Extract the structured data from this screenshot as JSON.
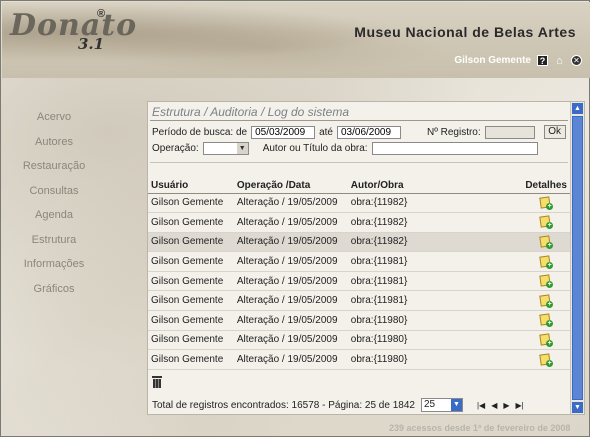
{
  "header": {
    "logo_text": "Donato",
    "logo_registered": "®",
    "logo_version": "3.1",
    "museum_name": "Museu Nacional de Belas Artes",
    "username": "Gilson Gemente",
    "icons": [
      "help-icon",
      "home-icon",
      "close-icon"
    ]
  },
  "sidebar": {
    "items": [
      {
        "label": "Acervo"
      },
      {
        "label": "Autores"
      },
      {
        "label": "Restauração"
      },
      {
        "label": "Consultas"
      },
      {
        "label": "Agenda"
      },
      {
        "label": "Estrutura"
      },
      {
        "label": "Informações"
      },
      {
        "label": "Gráficos"
      }
    ]
  },
  "panel": {
    "title": "Estrutura / Auditoria / Log do sistema",
    "filters": {
      "periodo_label": "Período de busca: de",
      "date_from": "05/03/2009",
      "ate_label": "até",
      "date_to": "03/06/2009",
      "registro_label": "Nº Registro:",
      "registro_value": "",
      "ok_label": "Ok",
      "operacao_label": "Operação:",
      "operacao_value": "",
      "autor_label": "Autor ou Título da obra:",
      "autor_value": ""
    },
    "table": {
      "columns": [
        "Usuário",
        "Operação /Data",
        "Autor/Obra",
        "Detalhes"
      ],
      "rows": [
        {
          "usuario": "Gilson Gemente",
          "operacao": "Alteração / 19/05/2009",
          "obra": "obra:{11982}"
        },
        {
          "usuario": "Gilson Gemente",
          "operacao": "Alteração / 19/05/2009",
          "obra": "obra:{11982}"
        },
        {
          "usuario": "Gilson Gemente",
          "operacao": "Alteração / 19/05/2009",
          "obra": "obra:{11982}"
        },
        {
          "usuario": "Gilson Gemente",
          "operacao": "Alteração / 19/05/2009",
          "obra": "obra:{11981}"
        },
        {
          "usuario": "Gilson Gemente",
          "operacao": "Alteração / 19/05/2009",
          "obra": "obra:{11981}"
        },
        {
          "usuario": "Gilson Gemente",
          "operacao": "Alteração / 19/05/2009",
          "obra": "obra:{11981}"
        },
        {
          "usuario": "Gilson Gemente",
          "operacao": "Alteração / 19/05/2009",
          "obra": "obra:{11980}"
        },
        {
          "usuario": "Gilson Gemente",
          "operacao": "Alteração / 19/05/2009",
          "obra": "obra:{11980}"
        },
        {
          "usuario": "Gilson Gemente",
          "operacao": "Alteração / 19/05/2009",
          "obra": "obra:{11980}"
        }
      ]
    },
    "footer": {
      "total_text": "Total de registros encontrados: 16578 - Página: 25 de 1842",
      "page_size": "25"
    }
  },
  "access_counter": "239 acessos desde 1º de fevereiro de 2008",
  "colors": {
    "accent": "#3a6cc5",
    "nav_text": "#8a867c",
    "title_text": "#7b8188"
  }
}
